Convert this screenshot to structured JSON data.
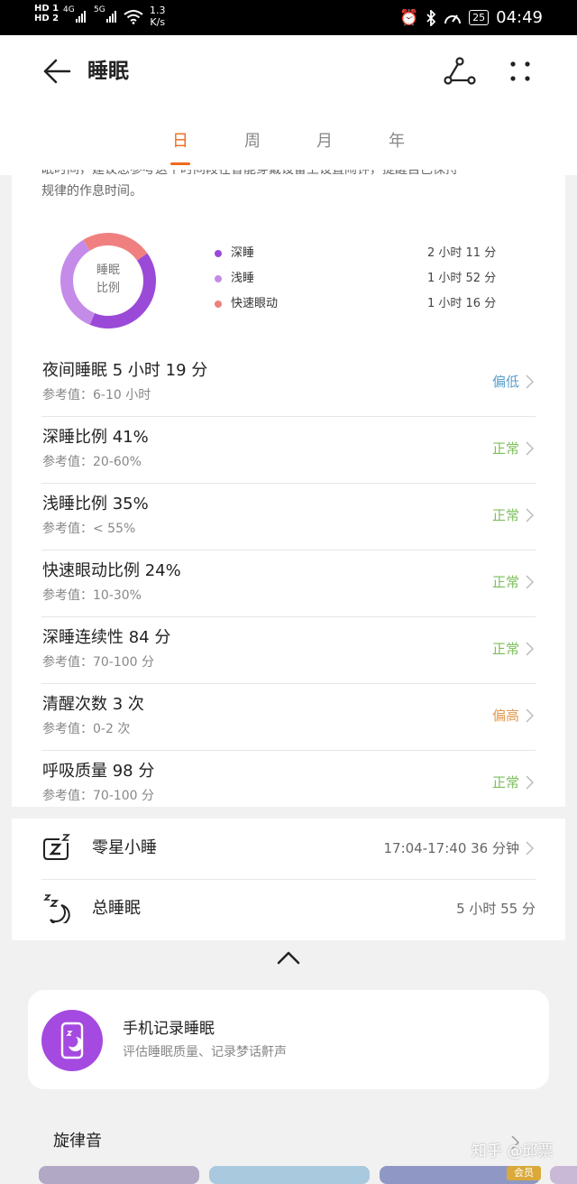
{
  "status_bar": {
    "hd1": "HD 1",
    "hd2": "HD 2",
    "net1": "4G",
    "net2": "5G",
    "speed_value": "1.3",
    "speed_unit": "K/s",
    "battery": "25",
    "time": "04:49"
  },
  "header": {
    "title": "睡眠",
    "tabs": [
      "日",
      "周",
      "月",
      "年"
    ],
    "active_tab": "日"
  },
  "summary": {
    "cutoff_line1": "眠时间，建议您参考这个时间段在智能穿戴设备上设置闹钟，提醒自己保持",
    "cutoff_line2": "规律的作息时间。",
    "donut_label_1": "睡眠",
    "donut_label_2": "比例",
    "legend": [
      {
        "name": "深睡",
        "value": "2 小时 11 分",
        "color": "#9b4ad8"
      },
      {
        "name": "浅睡",
        "value": "1 小时 52 分",
        "color": "#c58be8"
      },
      {
        "name": "快速眼动",
        "value": "1 小时 16 分",
        "color": "#f08080"
      }
    ]
  },
  "chart_data": {
    "type": "pie",
    "categories": [
      "深睡",
      "浅睡",
      "快速眼动"
    ],
    "values": [
      41,
      35,
      24
    ],
    "colors": [
      "#9b4ad8",
      "#c58be8",
      "#f08080"
    ]
  },
  "metrics": [
    {
      "title": "夜间睡眠  5 小时 19 分",
      "ref": "参考值：6-10 小时",
      "status": "偏低",
      "status_color": "#5b9ec9"
    },
    {
      "title": "深睡比例  41%",
      "ref": "参考值：20-60%",
      "status": "正常",
      "status_color": "#7cbf5b"
    },
    {
      "title": "浅睡比例  35%",
      "ref": "参考值：< 55%",
      "status": "正常",
      "status_color": "#7cbf5b"
    },
    {
      "title": "快速眼动比例  24%",
      "ref": "参考值：10-30%",
      "status": "正常",
      "status_color": "#7cbf5b"
    },
    {
      "title": "深睡连续性  84 分",
      "ref": "参考值：70-100 分",
      "status": "正常",
      "status_color": "#7cbf5b"
    },
    {
      "title": "清醒次数  3 次",
      "ref": "参考值：0-2 次",
      "status": "偏高",
      "status_color": "#e29a52"
    },
    {
      "title": "呼吸质量  98 分",
      "ref": "参考值：70-100 分",
      "status": "正常",
      "status_color": "#7cbf5b"
    }
  ],
  "naps": {
    "nap_label": "零星小睡",
    "nap_time": "17:04-17:40   36 分钟",
    "total_label": "总睡眠",
    "total_value": "5 小时 55 分"
  },
  "phone_record": {
    "title": "手机记录睡眠",
    "subtitle": "评估睡眠质量、记录梦话鼾声"
  },
  "melody": {
    "title": "旋律音",
    "badge": "会员"
  },
  "watermark": "知乎 @邱票"
}
